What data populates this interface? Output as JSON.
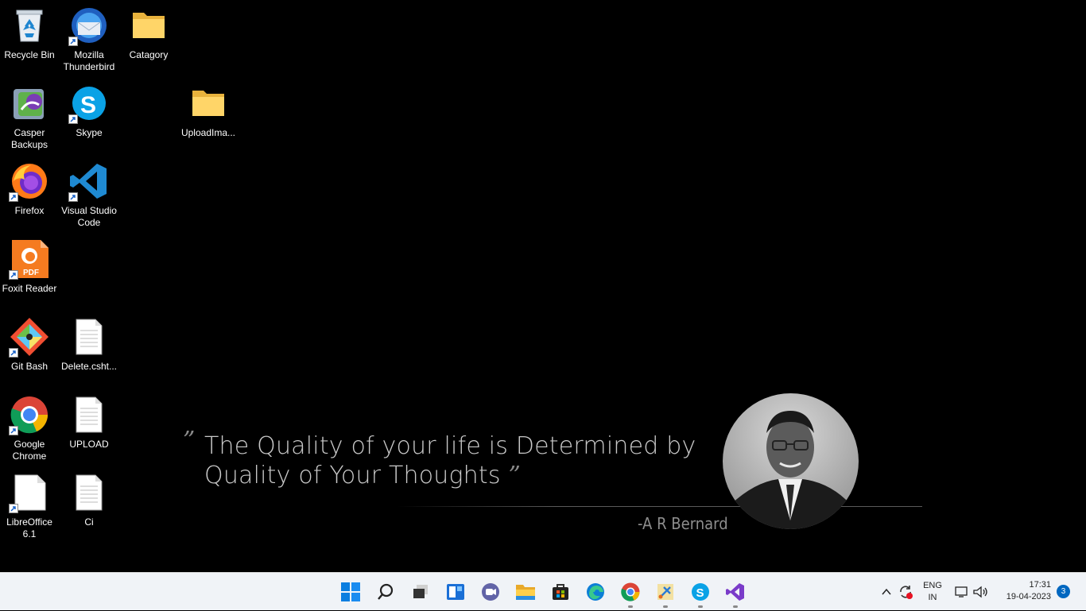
{
  "desktop": {
    "icons": {
      "recycle_bin": "Recycle Bin",
      "thunderbird": "Mozilla Thunderbird",
      "catagory": "Catagory",
      "casper": "Casper Backups",
      "skype": "Skype",
      "uploadimage": "UploadIma...",
      "firefox": "Firefox",
      "vscode": "Visual Studio Code",
      "foxit": "Foxit Reader",
      "gitbash": "Git Bash",
      "delete": "Delete.csht...",
      "chrome": "Google Chrome",
      "upload": "UPLOAD",
      "libreoffice": "LibreOffice 6.1",
      "ci": "Ci"
    }
  },
  "wallpaper": {
    "quote": "The Quality of your  life is Determined by Quality of Your Thoughts",
    "author": "-A R Bernard"
  },
  "taskbar": {
    "lang_line1": "ENG",
    "lang_line2": "IN",
    "time": "17:31",
    "date": "19-04-2023",
    "notifications": "3"
  }
}
